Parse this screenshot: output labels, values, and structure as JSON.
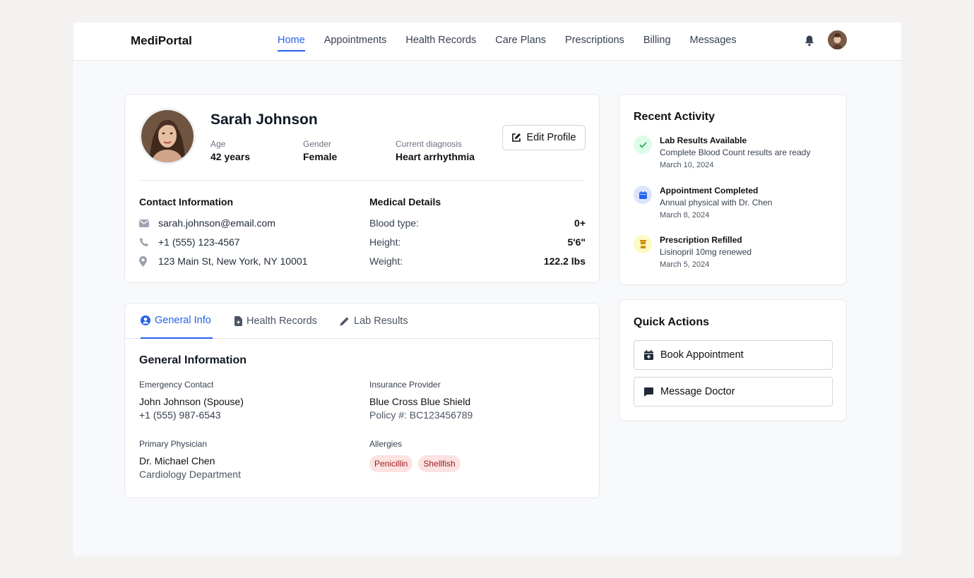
{
  "brand": "MediPortal",
  "nav": [
    "Home",
    "Appointments",
    "Health Records",
    "Care Plans",
    "Prescriptions",
    "Billing",
    "Messages"
  ],
  "profile": {
    "name": "Sarah Johnson",
    "age_label": "Age",
    "age": "42 years",
    "gender_label": "Gender",
    "gender": "Female",
    "diagnosis_label": "Current diagnosis",
    "diagnosis": "Heart arrhythmia",
    "edit_label": "Edit Profile"
  },
  "contact": {
    "title": "Contact Information",
    "email": "sarah.johnson@email.com",
    "phone": "+1 (555) 123-4567",
    "address": "123 Main St, New York, NY 10001"
  },
  "medical": {
    "title": "Medical Details",
    "rows": [
      {
        "label": "Blood type:",
        "value": "0+"
      },
      {
        "label": "Height:",
        "value": "5'6\""
      },
      {
        "label": "Weight:",
        "value": "122.2 lbs"
      }
    ]
  },
  "tabs": [
    "General Info",
    "Health Records",
    "Lab Results"
  ],
  "general": {
    "title": "General Information",
    "emergency": {
      "label": "Emergency Contact",
      "name": "John Johnson (Spouse)",
      "phone": "+1 (555) 987-6543"
    },
    "insurance": {
      "label": "Insurance Provider",
      "name": "Blue Cross Blue Shield",
      "policy": "Policy #: BC123456789"
    },
    "physician": {
      "label": "Primary Physician",
      "name": "Dr. Michael Chen",
      "dept": "Cardiology Department"
    },
    "allergies": {
      "label": "Allergies",
      "items": [
        "Penicillin",
        "Shellfish"
      ]
    }
  },
  "activity": {
    "title": "Recent Activity",
    "items": [
      {
        "title": "Lab Results Available",
        "desc": "Complete Blood Count results are ready",
        "date": "March 10, 2024",
        "icon": "check-icon"
      },
      {
        "title": "Appointment Completed",
        "desc": "Annual physical with Dr. Chen",
        "date": "March 8, 2024",
        "icon": "calendar-icon"
      },
      {
        "title": "Prescription Refilled",
        "desc": "Lisinopril 10mg renewed",
        "date": "March 5, 2024",
        "icon": "pill-bottle-icon"
      }
    ]
  },
  "quick": {
    "title": "Quick Actions",
    "book": "Book Appointment",
    "message": "Message Doctor"
  },
  "colors": {
    "accent": "#2563eb",
    "allergy_bg": "#fde2e2",
    "allergy_text": "#991b1b"
  }
}
